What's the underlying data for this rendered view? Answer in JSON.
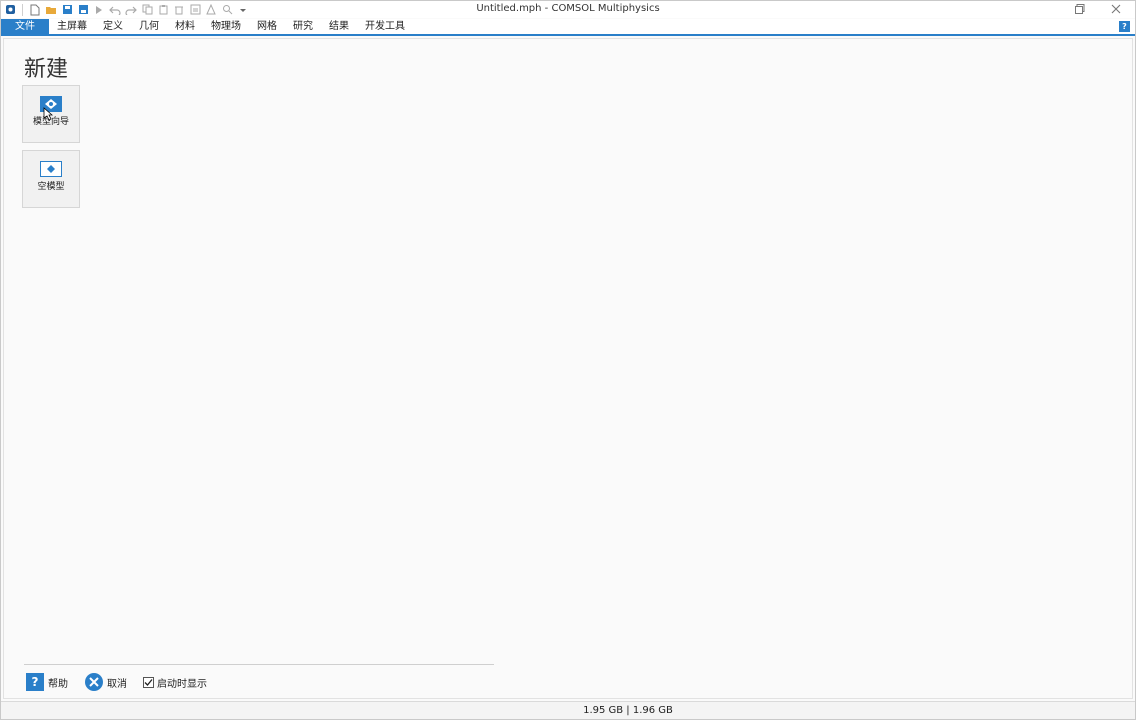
{
  "window": {
    "title": "Untitled.mph - COMSOL Multiphysics"
  },
  "quick_access": {
    "icons": [
      "app-icon",
      "new-file-icon",
      "open-folder-icon",
      "save-icon",
      "save-as-icon",
      "run-icon",
      "undo-icon",
      "redo-icon",
      "copy-icon",
      "paste-icon",
      "delete-icon",
      "build-all-icon",
      "compute-icon",
      "zoom-icon",
      "dropdown-icon"
    ]
  },
  "ribbon": {
    "tabs": [
      "文件",
      "主屏幕",
      "定义",
      "几何",
      "材料",
      "物理场",
      "网格",
      "研究",
      "结果",
      "开发工具"
    ],
    "active_tab": "文件"
  },
  "main": {
    "title": "新建",
    "tiles": [
      {
        "label": "模型向导",
        "icon": "model-wizard-icon"
      },
      {
        "label": "空模型",
        "icon": "blank-model-icon"
      }
    ]
  },
  "footer": {
    "help_label": "帮助",
    "cancel_label": "取消",
    "show_on_startup_label": "启动时显示",
    "show_on_startup_checked": true
  },
  "status": {
    "memory": "1.95 GB | 1.96 GB"
  },
  "colors": {
    "accent": "#2a7fc9"
  }
}
